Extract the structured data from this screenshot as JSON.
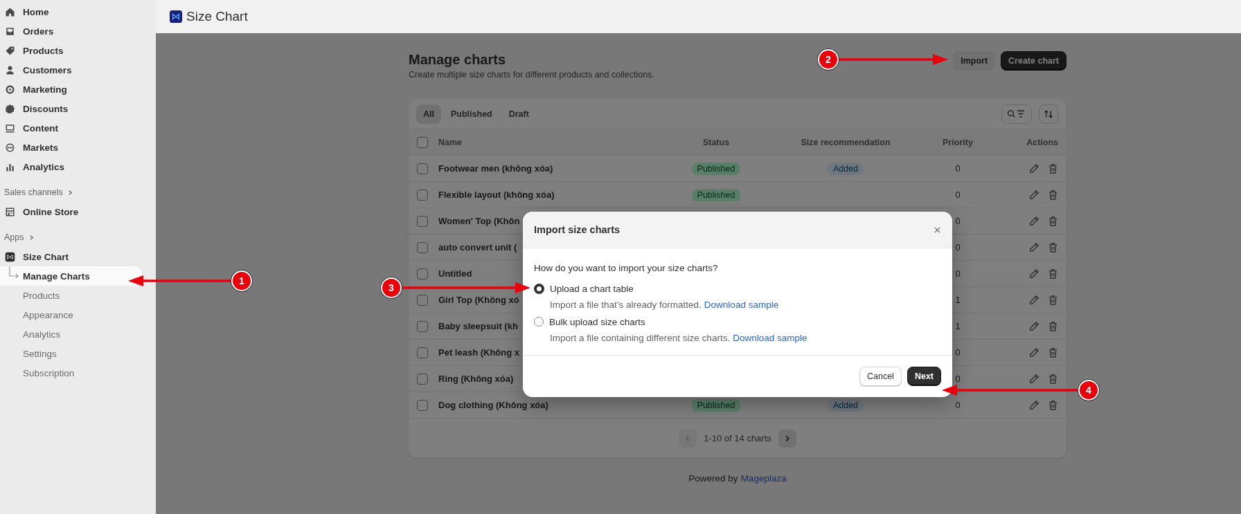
{
  "header": {
    "app_title": "Size Chart"
  },
  "sidebar": {
    "items": [
      {
        "label": "Home",
        "selected": false
      },
      {
        "label": "Orders",
        "selected": false
      },
      {
        "label": "Products",
        "selected": false
      },
      {
        "label": "Customers",
        "selected": false
      },
      {
        "label": "Marketing",
        "selected": false
      },
      {
        "label": "Discounts",
        "selected": false
      },
      {
        "label": "Content",
        "selected": false
      },
      {
        "label": "Markets",
        "selected": false
      },
      {
        "label": "Analytics",
        "selected": false
      }
    ],
    "sections": [
      {
        "label": "Sales channels",
        "items": [
          {
            "label": "Online Store",
            "selected": false
          }
        ]
      },
      {
        "label": "Apps",
        "items": [
          {
            "label": "Size Chart",
            "selected": false,
            "children": [
              {
                "label": "Manage Charts",
                "selected": true
              },
              {
                "label": "Products",
                "selected": false
              },
              {
                "label": "Appearance",
                "selected": false
              },
              {
                "label": "Analytics",
                "selected": false
              },
              {
                "label": "Settings",
                "selected": false
              },
              {
                "label": "Subscription",
                "selected": false
              }
            ]
          }
        ]
      }
    ]
  },
  "page": {
    "title": "Manage charts",
    "subtitle": "Create multiple size charts for different products and collections.",
    "buttons": [
      {
        "label": "Import",
        "kind": "secondary"
      },
      {
        "label": "Create chart",
        "kind": "primary"
      }
    ]
  },
  "table": {
    "tabs": [
      {
        "label": "All",
        "selected": true
      },
      {
        "label": "Published",
        "selected": false
      },
      {
        "label": "Draft",
        "selected": false
      }
    ],
    "select_all": {
      "checked": false
    },
    "columns": [
      "Name",
      "Status",
      "Size recommendation",
      "Priority",
      "Actions"
    ],
    "rows": [
      {
        "name": "Footwear men (không xóa)",
        "status": "Published",
        "size_recommendation": "Added",
        "priority": "0",
        "checked": false
      },
      {
        "name": "Flexible layout (không xóa)",
        "status": "Published",
        "priority": "0",
        "checked": false
      },
      {
        "name": "Women' Top (Khôn",
        "priority": "0",
        "checked": false
      },
      {
        "name": "auto convert unit (",
        "priority": "0",
        "checked": false
      },
      {
        "name": "Untitled",
        "priority": "0",
        "checked": false
      },
      {
        "name": "Girl Top (Không xó",
        "priority": "1",
        "checked": false
      },
      {
        "name": "Baby sleepsuit (kh",
        "priority": "1",
        "checked": false
      },
      {
        "name": "Pet leash (Không x",
        "priority": "0",
        "checked": false
      },
      {
        "name": "Ring (Không xóa)",
        "priority": "0",
        "checked": false
      },
      {
        "name": "Dog clothing (Không xóa)",
        "status": "Published",
        "size_recommendation": "Added",
        "priority": "0",
        "checked": false
      }
    ]
  },
  "pagination": {
    "label": "1-10 of 14 charts",
    "previous": {
      "disabled": true
    },
    "next": {
      "disabled": false
    }
  },
  "footer": {
    "text": "Powered by",
    "link": "Mageplaza"
  },
  "dialog": {
    "title": "Import size charts",
    "question": "How do you want to import your size charts?",
    "options": [
      {
        "label": "Upload a chart table",
        "description": "Import a file that’s already formatted.",
        "link": "Download sample",
        "selected": true
      },
      {
        "label": "Bulk upload size charts",
        "description": "Import a file containing different size charts.",
        "link": "Download sample",
        "selected": false
      }
    ],
    "buttons": [
      {
        "label": "Cancel",
        "kind": "secondary"
      },
      {
        "label": "Next",
        "kind": "primary"
      }
    ]
  },
  "annotations": [
    {
      "number": "1"
    },
    {
      "number": "2"
    },
    {
      "number": "3"
    },
    {
      "number": "4"
    }
  ]
}
